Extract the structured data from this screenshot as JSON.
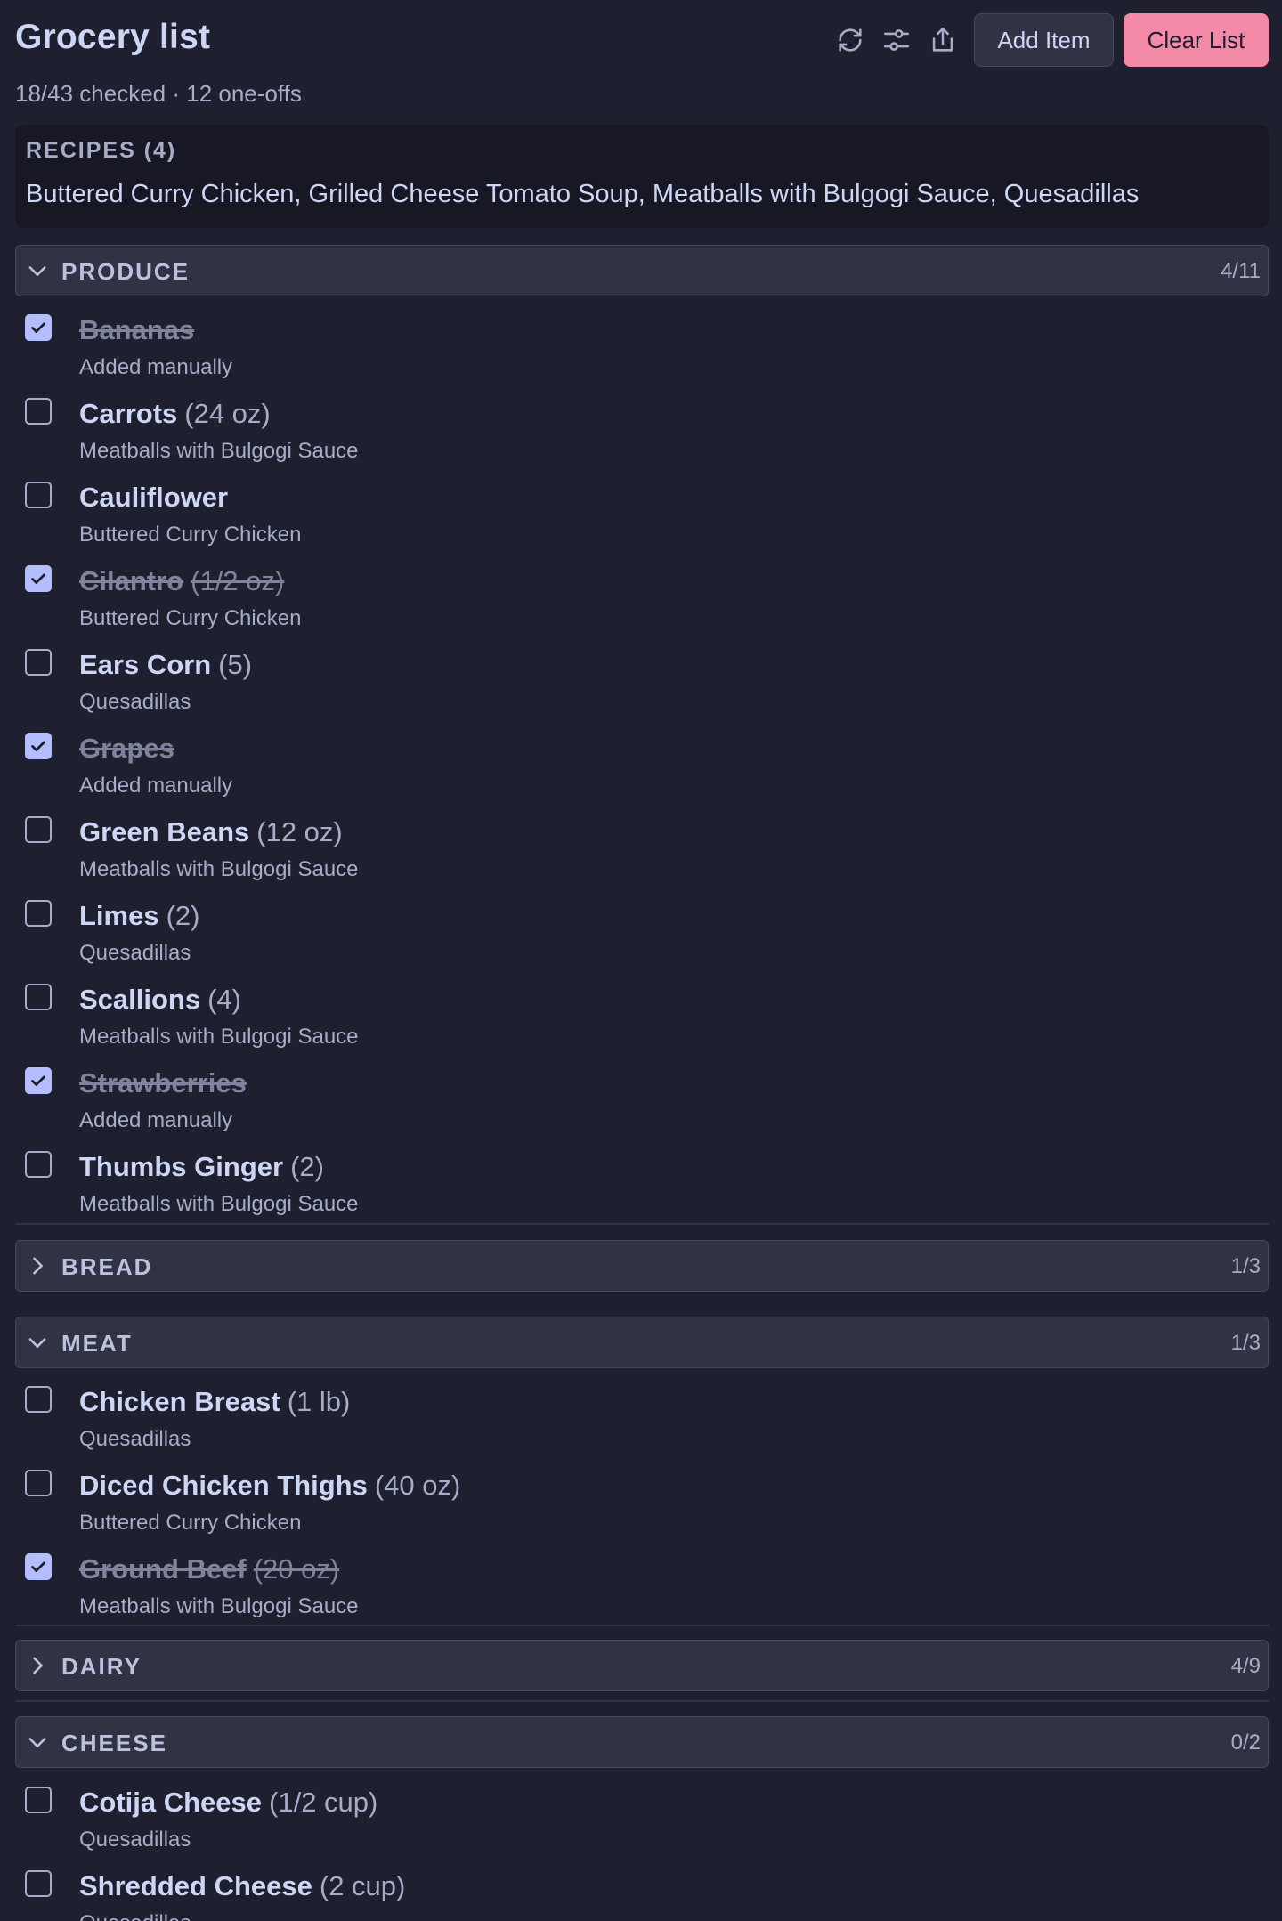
{
  "header": {
    "title": "Grocery list",
    "summary": "18/43 checked · 12 one-offs",
    "add_label": "Add Item",
    "clear_label": "Clear List"
  },
  "recipes": {
    "label": "RECIPES (4)",
    "list": "Buttered Curry Chicken, Grilled Cheese Tomato Soup, Meatballs with Bulgogi Sauce, Quesadillas"
  },
  "categories": {
    "produce": {
      "name": "PRODUCE",
      "count": "4/11",
      "expanded": true,
      "items": [
        {
          "name": "Bananas",
          "qty": "",
          "source": "Added manually",
          "checked": true
        },
        {
          "name": "Carrots",
          "qty": "(24 oz)",
          "source": "Meatballs with Bulgogi Sauce",
          "checked": false
        },
        {
          "name": "Cauliflower",
          "qty": "",
          "source": "Buttered Curry Chicken",
          "checked": false
        },
        {
          "name": "Cilantro",
          "qty": "(1/2 oz)",
          "source": "Buttered Curry Chicken",
          "checked": true
        },
        {
          "name": "Ears Corn",
          "qty": "(5)",
          "source": "Quesadillas",
          "checked": false
        },
        {
          "name": "Grapes",
          "qty": "",
          "source": "Added manually",
          "checked": true
        },
        {
          "name": "Green Beans",
          "qty": "(12 oz)",
          "source": "Meatballs with Bulgogi Sauce",
          "checked": false
        },
        {
          "name": "Limes",
          "qty": "(2)",
          "source": "Quesadillas",
          "checked": false
        },
        {
          "name": "Scallions",
          "qty": "(4)",
          "source": "Meatballs with Bulgogi Sauce",
          "checked": false
        },
        {
          "name": "Strawberries",
          "qty": "",
          "source": "Added manually",
          "checked": true
        },
        {
          "name": "Thumbs Ginger",
          "qty": "(2)",
          "source": "Meatballs with Bulgogi Sauce",
          "checked": false
        }
      ]
    },
    "bread": {
      "name": "BREAD",
      "count": "1/3",
      "expanded": false,
      "items": []
    },
    "meat": {
      "name": "MEAT",
      "count": "1/3",
      "expanded": true,
      "items": [
        {
          "name": "Chicken Breast",
          "qty": "(1 lb)",
          "source": "Quesadillas",
          "checked": false
        },
        {
          "name": "Diced Chicken Thighs",
          "qty": "(40 oz)",
          "source": "Buttered Curry Chicken",
          "checked": false
        },
        {
          "name": "Ground Beef",
          "qty": "(20 oz)",
          "source": "Meatballs with Bulgogi Sauce",
          "checked": true
        }
      ]
    },
    "dairy": {
      "name": "DAIRY",
      "count": "4/9",
      "expanded": false,
      "items": []
    },
    "cheese": {
      "name": "CHEESE",
      "count": "0/2",
      "expanded": true,
      "items": [
        {
          "name": "Cotija Cheese",
          "qty": "(1/2 cup)",
          "source": "Quesadillas",
          "checked": false
        },
        {
          "name": "Shredded Cheese",
          "qty": "(2 cup)",
          "source": "Quesadillas",
          "checked": false
        }
      ]
    }
  },
  "colors": {
    "background": "#1e1f2f",
    "accent_checkbox": "#b4befe",
    "clear_button": "#f38ba8"
  }
}
